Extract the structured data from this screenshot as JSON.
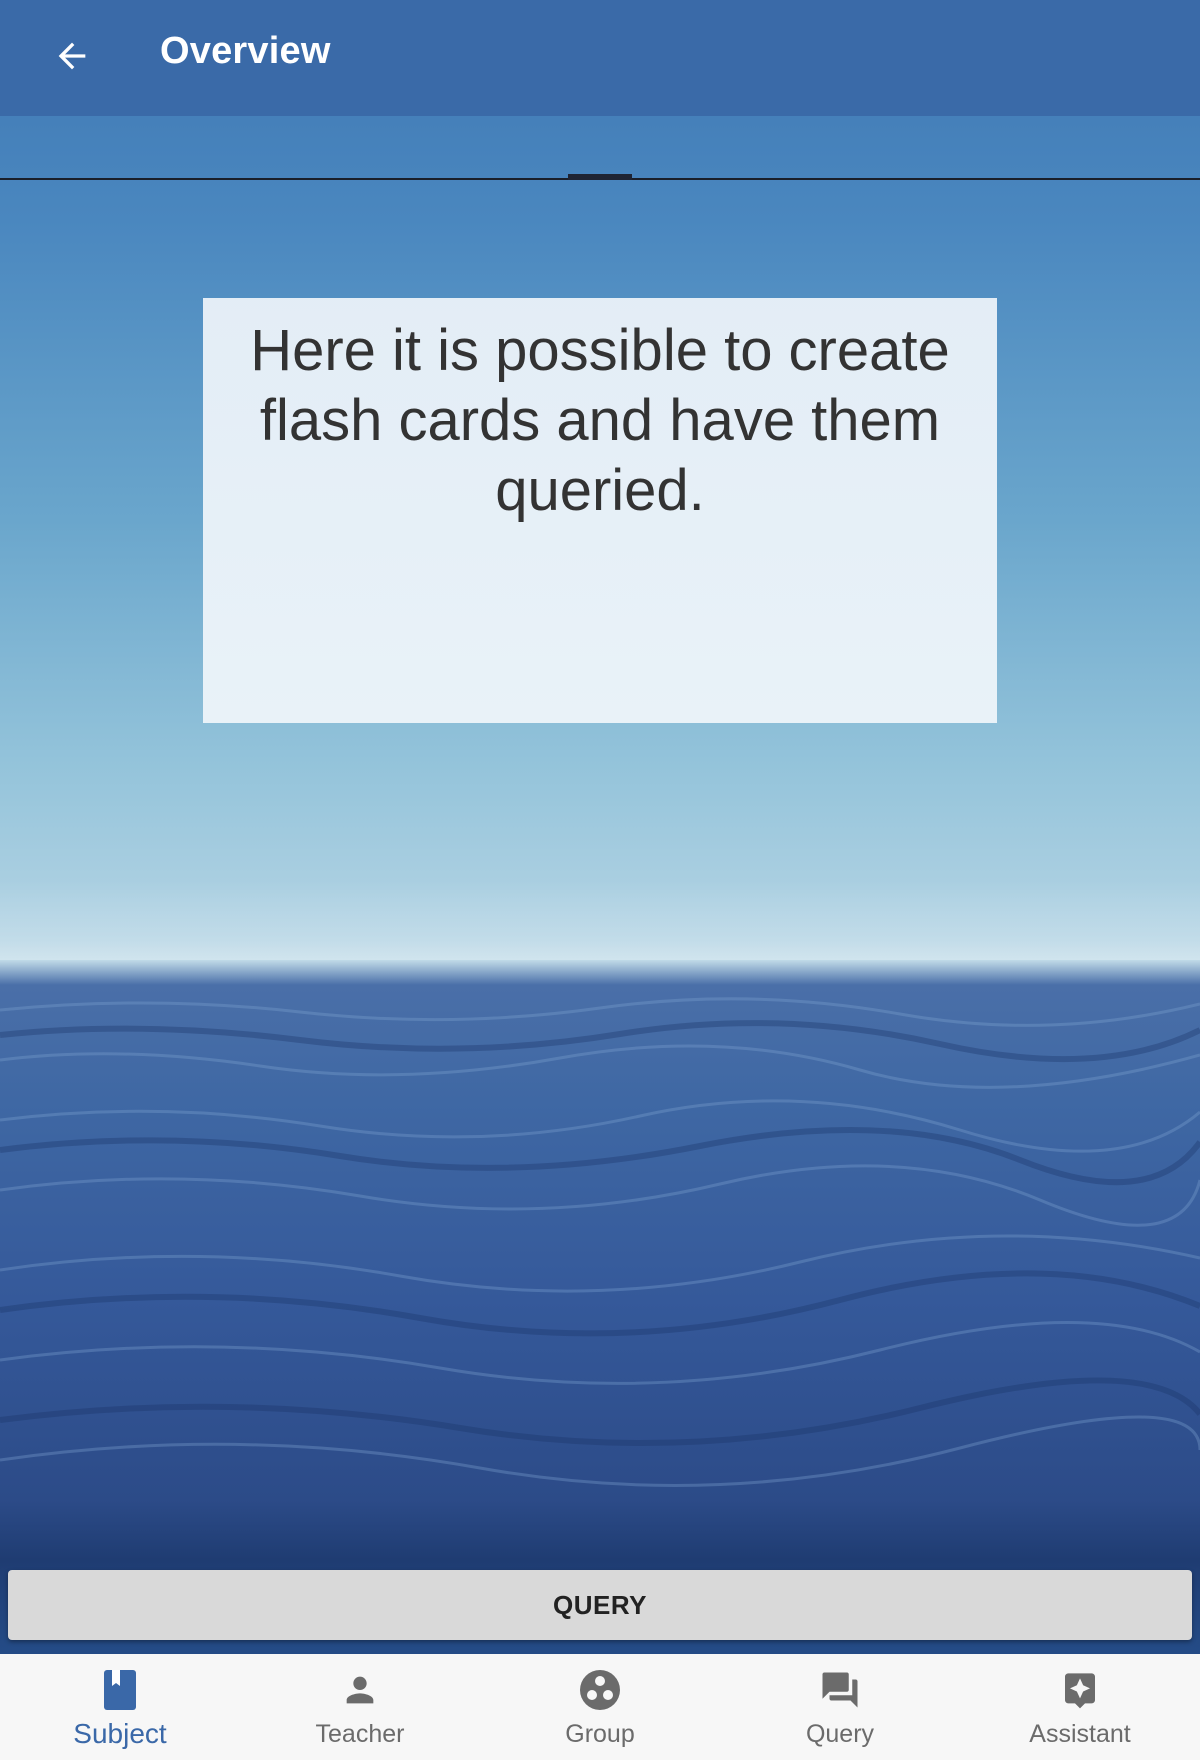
{
  "colors": {
    "appbar": "#3a6aa8",
    "active_nav": "#3a68a8",
    "inactive_nav": "#6b6b6b",
    "button_bg": "#d9d9d9"
  },
  "appbar": {
    "back_icon": "arrow-back-icon",
    "title": "Overview"
  },
  "card": {
    "text": "Here it is possible to create flash cards and have them queried."
  },
  "query_button": {
    "label": "QUERY"
  },
  "bottom_nav": {
    "active_index": 0,
    "items": [
      {
        "label": "Subject",
        "icon": "book-icon"
      },
      {
        "label": "Teacher",
        "icon": "person-icon"
      },
      {
        "label": "Group",
        "icon": "group-icon"
      },
      {
        "label": "Query",
        "icon": "chat-icon"
      },
      {
        "label": "Assistant",
        "icon": "assistant-icon"
      }
    ]
  }
}
